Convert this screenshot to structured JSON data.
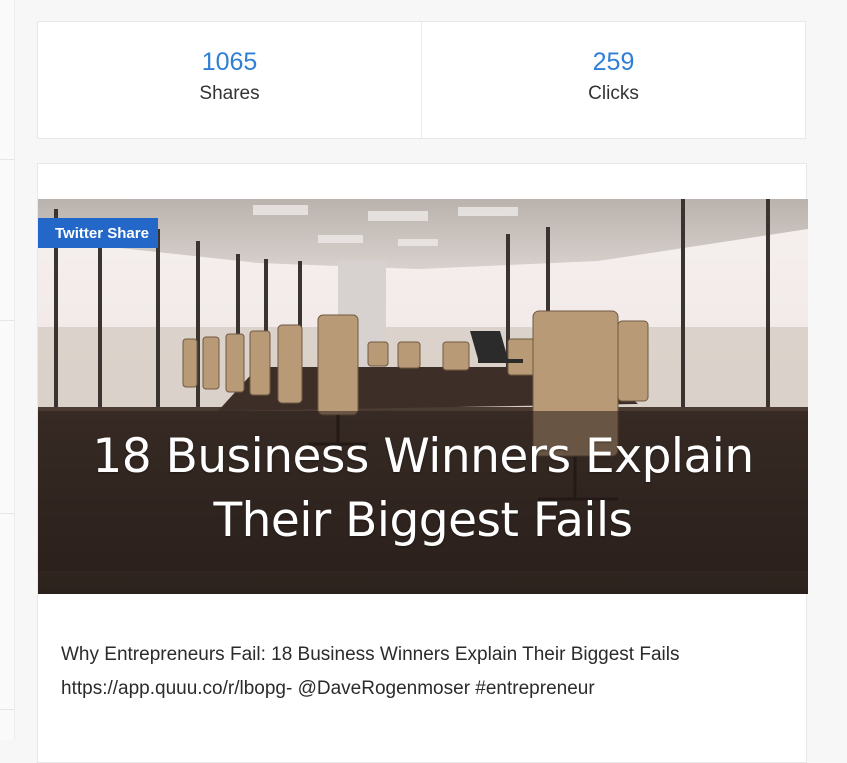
{
  "stats": [
    {
      "value": "1065",
      "label": "Shares"
    },
    {
      "value": "259",
      "label": "Clicks"
    }
  ],
  "post": {
    "badge": "Twitter Share",
    "image_title_line1": "18 Business Winners Explain",
    "image_title_line2": "Their Biggest Fails",
    "text_line1": "Why Entrepreneurs Fail: 18 Business Winners Explain Their Biggest Fails",
    "text_line2": "https://app.quuu.co/r/lbopg- @DaveRogenmoser #entrepreneur"
  },
  "colors": {
    "accent": "#2f7fd6",
    "badge": "#2368c8"
  }
}
